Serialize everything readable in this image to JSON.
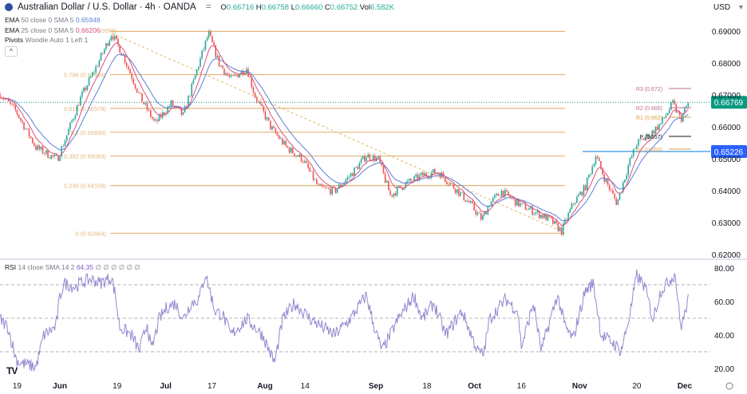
{
  "header": {
    "symbol": "Australian Dollar / U.S. Dollar · 4h · OANDA",
    "open_label": "O",
    "open": "0.66716",
    "high_label": "H",
    "high": "0.66758",
    "low_label": "L",
    "low": "0.66660",
    "close_label": "C",
    "close": "0.66752",
    "vol_label": "Vol",
    "vol": "6.582K",
    "currency": "USD"
  },
  "indicators": [
    {
      "name": "EMA",
      "params": "50 close 0 SMA 5",
      "value": "0.65948",
      "color": "#5b7fd6"
    },
    {
      "name": "EMA",
      "params": "25 close 0 SMA 5",
      "value": "0.66206",
      "extra": "(9996)",
      "color": "#d9507a"
    },
    {
      "name": "Pivots",
      "params": "Woodie Auto 1 Left 1"
    }
  ],
  "rsi_header": {
    "name": "RSI",
    "params": "14 close SMA 14 2",
    "value": "64.35",
    "placeholders": "∅ ∅ ∅ ∅ ∅ ∅"
  },
  "colors": {
    "up": "#26a69a",
    "down": "#ef5350",
    "ema50": "#5b7fd6",
    "ema25": "#d9507a",
    "fib": "#e3b578",
    "rsi": "#9486cf",
    "last_price": "#089981",
    "level_blue": "#2962ff"
  },
  "chart_data": [
    {
      "type": "candlestick",
      "title": "Australian Dollar / U.S. Dollar · 4h · OANDA",
      "ylim": [
        0.62,
        0.69
      ],
      "y_ticks": [
        "0.69000",
        "0.68000",
        "0.67000",
        "0.66000",
        "0.65000",
        "0.64000",
        "0.63000",
        "0.62000"
      ],
      "x_ticks": [
        {
          "label": "19",
          "day": 5
        },
        {
          "label": "Jun",
          "day": 17.5
        },
        {
          "label": "19",
          "day": 34.2
        },
        {
          "label": "Jul",
          "day": 48.4
        },
        {
          "label": "17",
          "day": 61.9
        },
        {
          "label": "Aug",
          "day": 77.4
        },
        {
          "label": "14",
          "day": 89.1
        },
        {
          "label": "Sep",
          "day": 109.8
        },
        {
          "label": "18",
          "day": 124.7
        },
        {
          "label": "Oct",
          "day": 138.6
        },
        {
          "label": "16",
          "day": 152.3
        },
        {
          "label": "Nov",
          "day": 169.3
        },
        {
          "label": "20",
          "day": 186
        },
        {
          "label": "Dec",
          "day": 200
        }
      ],
      "close_path": {
        "day": [
          0,
          4.7,
          10.5,
          16.7,
          18.6,
          23.3,
          29.1,
          32.6,
          36,
          40.7,
          45.3,
          50,
          53.5,
          58.1,
          60.9,
          64,
          67.4,
          72.1,
          74.4,
          79.1,
          83.7,
          88.4,
          93,
          97.7,
          102.3,
          107,
          110.5,
          114,
          118.6,
          123.3,
          127.9,
          132.6,
          137.2,
          140.7,
          143,
          146.5,
          151.2,
          155.8,
          160.5,
          164,
          167.4,
          170.9,
          174,
          176.7,
          180.2,
          183.7,
          186,
          189.5,
          193,
          196.5,
          198.8,
          201.2
        ],
        "price": [
          0.6703,
          0.6648,
          0.6535,
          0.6498,
          0.6548,
          0.6685,
          0.681,
          0.6893,
          0.6823,
          0.6698,
          0.661,
          0.6673,
          0.6635,
          0.6798,
          0.6893,
          0.6798,
          0.6748,
          0.6785,
          0.6698,
          0.6598,
          0.6535,
          0.6498,
          0.641,
          0.6398,
          0.6448,
          0.651,
          0.6498,
          0.6385,
          0.6423,
          0.6448,
          0.646,
          0.641,
          0.636,
          0.631,
          0.636,
          0.6398,
          0.636,
          0.6335,
          0.631,
          0.6273,
          0.636,
          0.641,
          0.651,
          0.6435,
          0.636,
          0.6485,
          0.6548,
          0.6573,
          0.661,
          0.6673,
          0.6623,
          0.6677
        ]
      },
      "last_price": "0.66769",
      "marked_level": "0.65226",
      "fibonacci": [
        {
          "ratio": "1",
          "price": 0.6899,
          "label": ""
        },
        {
          "ratio": "0.786",
          "price": 0.67636,
          "label": "0.786 (0.67636)"
        },
        {
          "ratio": "0.618",
          "price": 0.66578,
          "label": "0.618 (0.66578)"
        },
        {
          "ratio": "0.5",
          "price": 0.6583,
          "label": "0.5 (0.65830)"
        },
        {
          "ratio": "0.382",
          "price": 0.65083,
          "label": "0.382 (0.65083)"
        },
        {
          "ratio": "0.236",
          "price": 0.64159,
          "label": "0.236 (0.64159)"
        },
        {
          "ratio": "0",
          "price": 0.62664,
          "label": "0 (0.62664)"
        }
      ],
      "trendline": {
        "from": {
          "day": 32.6,
          "price": 0.6893
        },
        "to": {
          "day": 164,
          "price": 0.6273
        }
      },
      "pivots": [
        {
          "label": "R3 (0.672)",
          "price": 0.672,
          "color": "#c06a93"
        },
        {
          "label": "R2 (0.666)",
          "price": 0.666,
          "color": "#c06a93"
        },
        {
          "label": "R1 (0.663)",
          "price": 0.663,
          "color": "#d9a24a"
        },
        {
          "label": "P (0.657)",
          "price": 0.657,
          "color": "#131722"
        },
        {
          "label": "S1 (0.653)",
          "price": 0.653,
          "color": "#d9a24a"
        }
      ]
    },
    {
      "type": "line",
      "title": "RSI 14 close SMA 14 2",
      "ylim": [
        15,
        85
      ],
      "y_ticks": [
        "80.00",
        "60.00",
        "40.00",
        "20.00"
      ],
      "bands": [
        70,
        50,
        30
      ],
      "day": [
        0,
        2.3,
        4.7,
        5.8,
        10.5,
        12.8,
        16.3,
        17.4,
        18.6,
        22.1,
        23.3,
        26.7,
        29.1,
        32.6,
        33.7,
        34.9,
        38.4,
        40.7,
        43,
        44.2,
        46.5,
        48.8,
        51.2,
        53.5,
        55.8,
        58.1,
        60,
        61.6,
        62.8,
        65.1,
        67.4,
        69.8,
        72.1,
        76.7,
        80.2,
        82.6,
        86,
        90.7,
        97.7,
        102.3,
        107,
        109.3,
        111.6,
        116.3,
        120.9,
        123.3,
        126.7,
        130.2,
        134.9,
        139.5,
        141.2,
        143,
        147.7,
        151.2,
        152.3,
        155.8,
        158.1,
        162.8,
        165.1,
        167.4,
        170.9,
        173.3,
        175.6,
        179.1,
        181.4,
        183.7,
        186,
        188.4,
        190.7,
        193,
        197.2,
        198.8,
        200,
        201.2
      ],
      "values": [
        49.5,
        44.8,
        25.7,
        23.3,
        21,
        40,
        44.8,
        61.4,
        71,
        68.6,
        71,
        73.3,
        71,
        74.3,
        63.8,
        44.8,
        40,
        30.5,
        47.1,
        30.5,
        49.5,
        56.7,
        59,
        49.5,
        59,
        61.4,
        76.7,
        63.8,
        54.3,
        51.9,
        40,
        44.8,
        49.5,
        40,
        23.3,
        49.5,
        59,
        49.5,
        40,
        49.5,
        63.8,
        44.8,
        30.5,
        49.5,
        63.8,
        49.5,
        59,
        40,
        54.3,
        30.5,
        28.1,
        49.5,
        61.4,
        54.3,
        32.9,
        59,
        30.5,
        63.8,
        44.8,
        37.6,
        66.2,
        71,
        40,
        35.2,
        30.5,
        49.5,
        75.7,
        68.6,
        49.5,
        66.2,
        76.7,
        44.8,
        51.9,
        64.35
      ]
    }
  ]
}
